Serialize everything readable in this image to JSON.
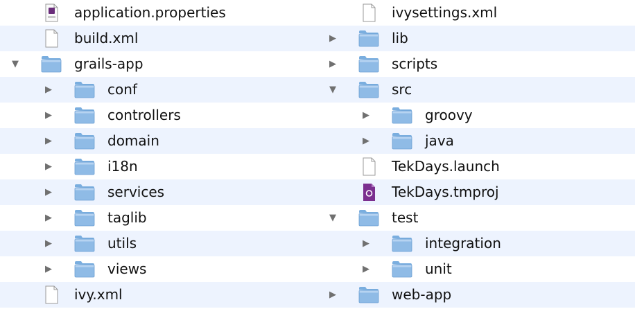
{
  "left_column": [
    {
      "label": "application.properties",
      "icon": "properties-file-icon",
      "level": 1,
      "disclosure": "none"
    },
    {
      "label": "build.xml",
      "icon": "document-icon",
      "level": 1,
      "disclosure": "none"
    },
    {
      "label": "grails-app",
      "icon": "folder-icon",
      "level": 1,
      "disclosure": "expanded"
    },
    {
      "label": "conf",
      "icon": "folder-icon",
      "level": 2,
      "disclosure": "collapsed"
    },
    {
      "label": "controllers",
      "icon": "folder-icon",
      "level": 2,
      "disclosure": "collapsed"
    },
    {
      "label": "domain",
      "icon": "folder-icon",
      "level": 2,
      "disclosure": "collapsed"
    },
    {
      "label": "i18n",
      "icon": "folder-icon",
      "level": 2,
      "disclosure": "collapsed"
    },
    {
      "label": "services",
      "icon": "folder-icon",
      "level": 2,
      "disclosure": "collapsed"
    },
    {
      "label": "taglib",
      "icon": "folder-icon",
      "level": 2,
      "disclosure": "collapsed"
    },
    {
      "label": "utils",
      "icon": "folder-icon",
      "level": 2,
      "disclosure": "collapsed"
    },
    {
      "label": "views",
      "icon": "folder-icon",
      "level": 2,
      "disclosure": "collapsed"
    },
    {
      "label": "ivy.xml",
      "icon": "document-icon",
      "level": 1,
      "disclosure": "none"
    }
  ],
  "right_column": [
    {
      "label": "ivysettings.xml",
      "icon": "document-icon",
      "level": 1,
      "disclosure": "none"
    },
    {
      "label": "lib",
      "icon": "folder-icon",
      "level": 1,
      "disclosure": "collapsed"
    },
    {
      "label": "scripts",
      "icon": "folder-icon",
      "level": 1,
      "disclosure": "collapsed"
    },
    {
      "label": "src",
      "icon": "folder-icon",
      "level": 1,
      "disclosure": "expanded"
    },
    {
      "label": "groovy",
      "icon": "folder-icon",
      "level": 2,
      "disclosure": "collapsed"
    },
    {
      "label": "java",
      "icon": "folder-icon",
      "level": 2,
      "disclosure": "collapsed"
    },
    {
      "label": "TekDays.launch",
      "icon": "document-icon",
      "level": 1,
      "disclosure": "none"
    },
    {
      "label": "TekDays.tmproj",
      "icon": "tmproj-file-icon",
      "level": 1,
      "disclosure": "none"
    },
    {
      "label": "test",
      "icon": "folder-icon",
      "level": 1,
      "disclosure": "expanded"
    },
    {
      "label": "integration",
      "icon": "folder-icon",
      "level": 2,
      "disclosure": "collapsed"
    },
    {
      "label": "unit",
      "icon": "folder-icon",
      "level": 2,
      "disclosure": "collapsed"
    },
    {
      "label": "web-app",
      "icon": "folder-icon",
      "level": 1,
      "disclosure": "collapsed"
    }
  ],
  "colors": {
    "stripe": "#edf3fe",
    "folder_body": "#8fbbe6",
    "folder_tab": "#7aaedf",
    "tmproj_purple": "#7b2f8f"
  }
}
